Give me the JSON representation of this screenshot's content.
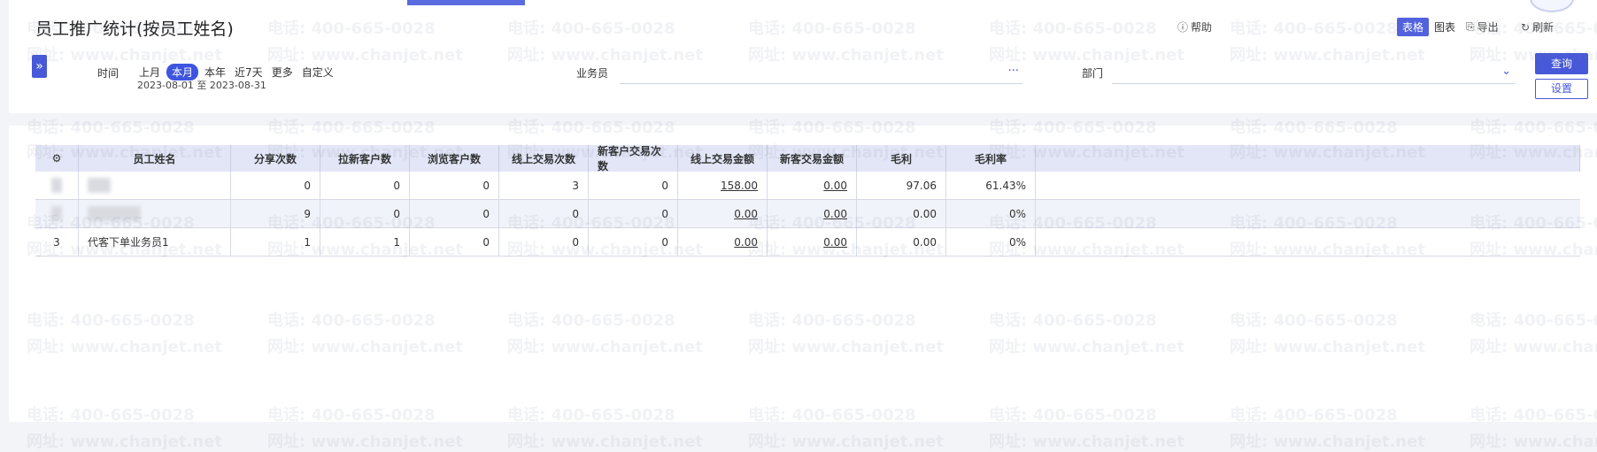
{
  "page": {
    "title": "员工推广统计(按员工姓名)"
  },
  "toolbar": {
    "help": "帮助",
    "view_table": "表格",
    "view_chart": "图表",
    "export": "导出",
    "refresh": "刷新"
  },
  "filters": {
    "time_label": "时间",
    "chips": [
      "上月",
      "本月",
      "本年",
      "近7天",
      "更多",
      "自定义"
    ],
    "active_chip": "本月",
    "date_range": "2023-08-01 至 2023-08-31",
    "salesperson_label": "业务员",
    "salesperson_trailing": "···",
    "department_label": "部门",
    "department_trailing": "⌄",
    "query_button": "查询",
    "settings_button": "设置"
  },
  "table": {
    "headers": [
      "员工姓名",
      "分享次数",
      "拉新客户数",
      "浏览客户数",
      "线上交易次数",
      "新客户交易次数",
      "线上交易金额",
      "新客交易金额",
      "毛利",
      "毛利率"
    ],
    "rows": [
      {
        "seq": "",
        "name": "",
        "share": "0",
        "new_customers": "0",
        "browse": "0",
        "online_tx": "3",
        "new_tx": "0",
        "online_amount": "158.00",
        "new_amount": "0.00",
        "gross": "97.06",
        "margin": "61.43%"
      },
      {
        "seq": "",
        "name": "",
        "share": "9",
        "new_customers": "0",
        "browse": "0",
        "online_tx": "0",
        "new_tx": "0",
        "online_amount": "0.00",
        "new_amount": "0.00",
        "gross": "0.00",
        "margin": "0%"
      },
      {
        "seq": "3",
        "name": "代客下单业务员1",
        "share": "1",
        "new_customers": "1",
        "browse": "0",
        "online_tx": "0",
        "new_tx": "0",
        "online_amount": "0.00",
        "new_amount": "0.00",
        "gross": "0.00",
        "margin": "0%"
      }
    ]
  },
  "watermark": {
    "phone": "电话: 400-665-0028",
    "site": "网址: www.chanjet.net"
  },
  "colors": {
    "accent": "#4758d8",
    "header_bg": "#e2e6f6",
    "scroll": "#2bbf6a"
  }
}
